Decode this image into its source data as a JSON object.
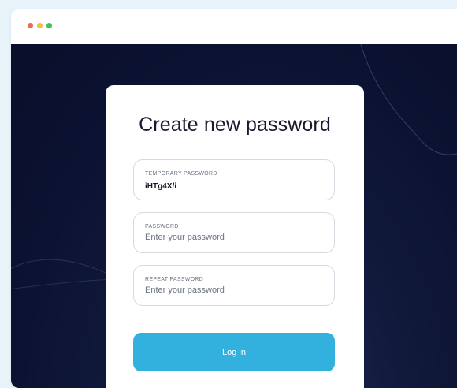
{
  "window": {
    "traffic_lights": [
      "#f06a5c",
      "#f3bf3f",
      "#3fc05a"
    ]
  },
  "form": {
    "title": "Create new password",
    "fields": [
      {
        "label": "TEMPORARY PASSWORD",
        "value": "iHTg4X/i"
      },
      {
        "label": "PASSWORD",
        "placeholder": "Enter your password"
      },
      {
        "label": "REPEAT PASSWORD",
        "placeholder": "Enter your password"
      }
    ],
    "submit_label": "Log in"
  },
  "colors": {
    "page_background": "#e7f3f8",
    "viewport_background": "#0b1130",
    "accent": "#33b1de",
    "card": "#ffffff"
  }
}
